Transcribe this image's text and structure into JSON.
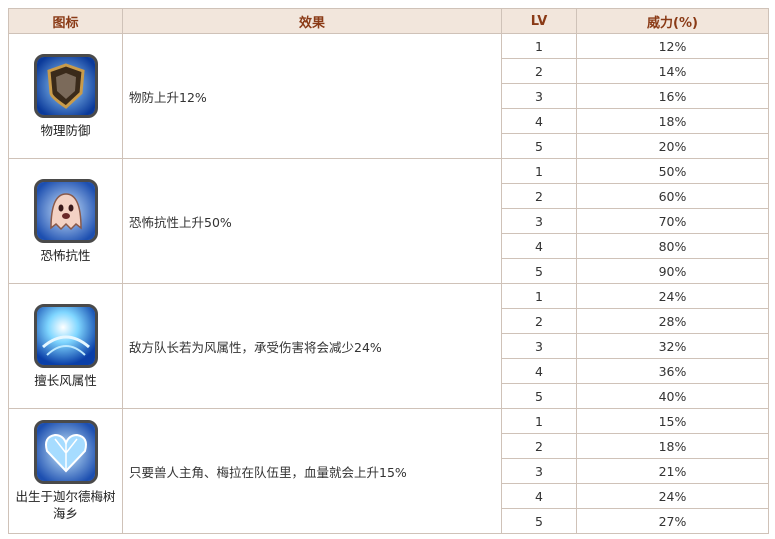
{
  "headers": {
    "icon": "图标",
    "effect": "效果",
    "lv": "LV",
    "power": "威力(%)"
  },
  "rows": [
    {
      "icon_name": "shield-icon",
      "icon_label": "物理防御",
      "effect": "物防上升12%",
      "levels": [
        {
          "lv": "1",
          "power": "12%"
        },
        {
          "lv": "2",
          "power": "14%"
        },
        {
          "lv": "3",
          "power": "16%"
        },
        {
          "lv": "4",
          "power": "18%"
        },
        {
          "lv": "5",
          "power": "20%"
        }
      ]
    },
    {
      "icon_name": "ghost-icon",
      "icon_label": "恐怖抗性",
      "effect": "恐怖抗性上升50%",
      "levels": [
        {
          "lv": "1",
          "power": "50%"
        },
        {
          "lv": "2",
          "power": "60%"
        },
        {
          "lv": "3",
          "power": "70%"
        },
        {
          "lv": "4",
          "power": "80%"
        },
        {
          "lv": "5",
          "power": "90%"
        }
      ]
    },
    {
      "icon_name": "wind-orb-icon",
      "icon_label": "擅长风属性",
      "effect": "敌方队长若为风属性，承受伤害将会减少24%",
      "levels": [
        {
          "lv": "1",
          "power": "24%"
        },
        {
          "lv": "2",
          "power": "28%"
        },
        {
          "lv": "3",
          "power": "32%"
        },
        {
          "lv": "4",
          "power": "36%"
        },
        {
          "lv": "5",
          "power": "40%"
        }
      ]
    },
    {
      "icon_name": "crystal-heart-icon",
      "icon_label": "出生于迦尔德梅树海乡",
      "effect": "只要兽人主角、梅拉在队伍里，血量就会上升15%",
      "levels": [
        {
          "lv": "1",
          "power": "15%"
        },
        {
          "lv": "2",
          "power": "18%"
        },
        {
          "lv": "3",
          "power": "21%"
        },
        {
          "lv": "4",
          "power": "24%"
        },
        {
          "lv": "5",
          "power": "27%"
        }
      ]
    }
  ]
}
